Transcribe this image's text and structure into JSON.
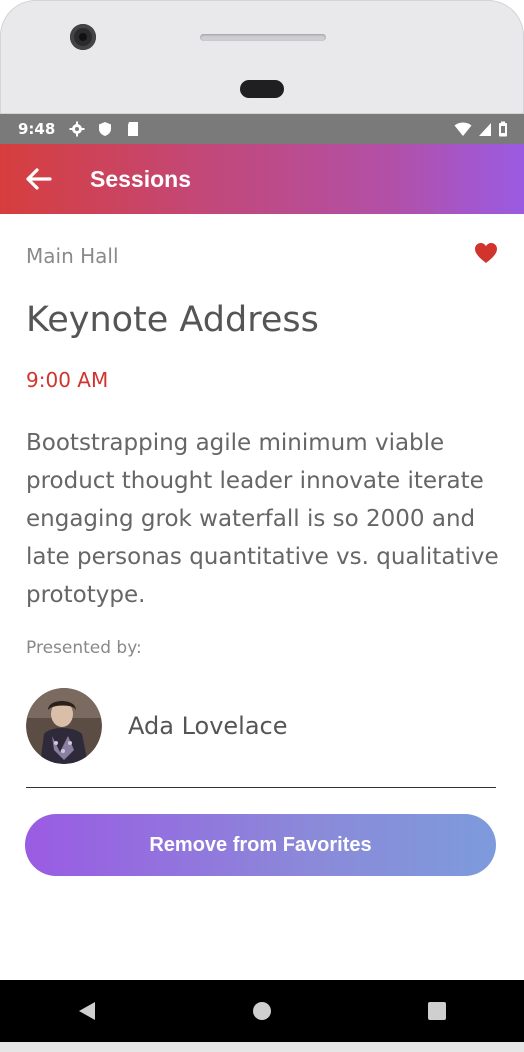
{
  "status_bar": {
    "time": "9:48"
  },
  "app_bar": {
    "title": "Sessions"
  },
  "session": {
    "location": "Main Hall",
    "title": "Keynote Address",
    "time": "9:00 AM",
    "description": "Bootstrapping agile minimum viable product thought leader innovate iterate engaging grok waterfall is so 2000 and late personas quantitative vs. qualitative prototype.",
    "presented_by_label": "Presented by:",
    "speaker_name": "Ada Lovelace",
    "favorite_button_label": "Remove from Favorites",
    "is_favorite": true
  },
  "icons": {
    "back": "arrow-left-icon",
    "favorite": "heart-icon",
    "status_left": [
      "gear-icon",
      "shield-icon",
      "sd-card-icon"
    ],
    "status_right": [
      "wifi-icon",
      "cellular-icon",
      "battery-icon"
    ],
    "nav": [
      "back-triangle-icon",
      "home-circle-icon",
      "recents-square-icon"
    ]
  },
  "colors": {
    "accent_red": "#d0342c",
    "app_bar_gradient_start": "#d63e3e",
    "app_bar_gradient_end": "#9a5be3",
    "button_gradient_start": "#9a5be3",
    "button_gradient_end": "#7d9bdc"
  }
}
